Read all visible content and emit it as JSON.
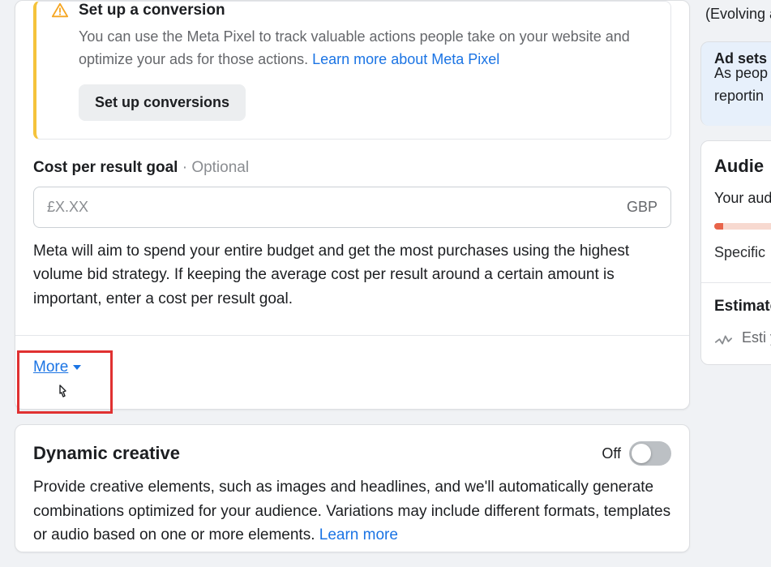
{
  "conversion": {
    "title": "Set up a conversion",
    "desc_prefix": "You can use the Meta Pixel to track valuable actions people take on your website and optimize your ads for those actions. ",
    "learn_link": "Learn more about Meta Pixel",
    "button": "Set up conversions"
  },
  "cost_goal": {
    "label": "Cost per result goal",
    "optional": "Optional",
    "placeholder": "£X.XX",
    "currency": "GBP",
    "helper": "Meta will aim to spend your entire budget and get the most purchases using the highest volume bid strategy. If keeping the average cost per result around a certain amount is important, enter a cost per result goal."
  },
  "more_label": "More",
  "dynamic": {
    "title": "Dynamic creative",
    "toggle_state": "Off",
    "desc_prefix": "Provide creative elements, such as images and headlines, and we'll automatically generate combinations optimized for your audience. Variations may include different formats, templates or audio based on one or more elements. ",
    "learn_link": "Learn more"
  },
  "right": {
    "evolving": "(Evolving affect y",
    "adsets_head": "Ad sets th",
    "adsets_body": "As peop controls reportin",
    "audience_title": "Audie",
    "audience_sub": "Your audi",
    "spectrum_label": "Specific",
    "est_title": "Estimated",
    "est_body": "Esti your not "
  }
}
